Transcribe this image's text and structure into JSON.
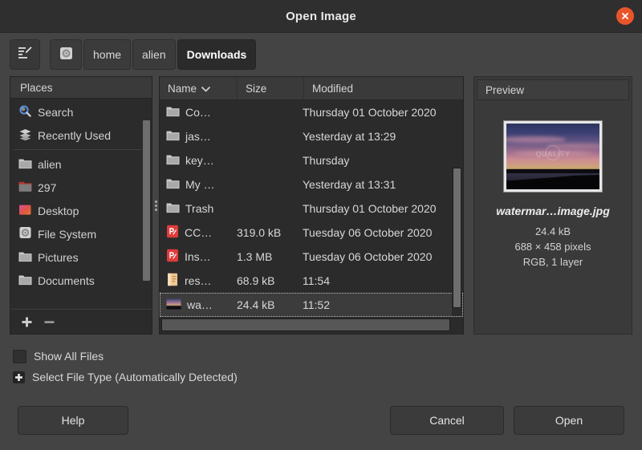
{
  "window": {
    "title": "Open Image",
    "close_icon": "close-icon"
  },
  "toolbar": {
    "type_filename_icon": "type-filename-icon",
    "path_buttons": [
      {
        "label": "",
        "icon": "disk-icon",
        "active": false
      },
      {
        "label": "home",
        "icon": "",
        "active": false
      },
      {
        "label": "alien",
        "icon": "",
        "active": false
      },
      {
        "label": "Downloads",
        "icon": "",
        "active": true
      }
    ]
  },
  "places": {
    "header": "Places",
    "items": [
      {
        "label": "Search",
        "icon": "search-icon"
      },
      {
        "label": "Recently Used",
        "icon": "recent-icon"
      },
      {
        "separator": true
      },
      {
        "label": "alien",
        "icon": "folder-icon"
      },
      {
        "label": "297",
        "icon": "drive-icon"
      },
      {
        "label": "Desktop",
        "icon": "desktop-icon"
      },
      {
        "label": "File System",
        "icon": "filesystem-icon"
      },
      {
        "label": "Pictures",
        "icon": "folder-icon"
      },
      {
        "label": "Documents",
        "icon": "folder-icon"
      }
    ],
    "add_label": "+",
    "remove_label": "−"
  },
  "file_list": {
    "columns": [
      {
        "key": "name",
        "label": "Name",
        "sorted": true,
        "sort_icon": "chevron-down-icon"
      },
      {
        "key": "size",
        "label": "Size",
        "sorted": false
      },
      {
        "key": "modified",
        "label": "Modified",
        "sorted": false
      }
    ],
    "rows": [
      {
        "name": "Co…",
        "size": "",
        "modified": "Thursday 01 October 2020",
        "icon": "folder-icon",
        "selected": false
      },
      {
        "name": "jas…",
        "size": "",
        "modified": "Yesterday at 13:29",
        "icon": "folder-icon",
        "selected": false
      },
      {
        "name": "key…",
        "size": "",
        "modified": "Thursday",
        "icon": "folder-icon",
        "selected": false
      },
      {
        "name": "My …",
        "size": "",
        "modified": "Yesterday at 13:31",
        "icon": "folder-icon",
        "selected": false
      },
      {
        "name": "Trash",
        "size": "",
        "modified": "Thursday 01 October 2020",
        "icon": "folder-icon",
        "selected": false
      },
      {
        "name": "CC…",
        "size": "319.0 kB",
        "modified": "Tuesday 06 October 2020",
        "icon": "pdf-icon",
        "selected": false
      },
      {
        "name": "Ins…",
        "size": "1.3 MB",
        "modified": "Tuesday 06 October 2020",
        "icon": "pdf-icon",
        "selected": false
      },
      {
        "name": "res…",
        "size": "68.9 kB",
        "modified": "11:54",
        "icon": "document-icon",
        "selected": false
      },
      {
        "name": "wa…",
        "size": "24.4 kB",
        "modified": "11:52",
        "icon": "image-icon",
        "selected": true
      }
    ]
  },
  "preview": {
    "header": "Preview",
    "filename": "watermar…image.jpg",
    "filesize": "24.4 kB",
    "dimensions": "688 × 458 pixels",
    "colormode": "RGB, 1 layer",
    "watermark_text": "QUALITY"
  },
  "options": {
    "show_all_files": {
      "label": "Show All Files",
      "checked": false
    },
    "select_file_type": {
      "label": "Select File Type (Automatically Detected)",
      "expanded": false,
      "expander_icon": "plus-icon"
    }
  },
  "footer": {
    "help": "Help",
    "cancel": "Cancel",
    "open": "Open"
  },
  "colors": {
    "dialog_bg": "#444444",
    "titlebar_bg": "#2f2f2f",
    "panel_bg": "#2b2b2b",
    "header_bg": "#3a3a3a",
    "close_accent": "#e9552a",
    "text": "#d8d8d8"
  }
}
